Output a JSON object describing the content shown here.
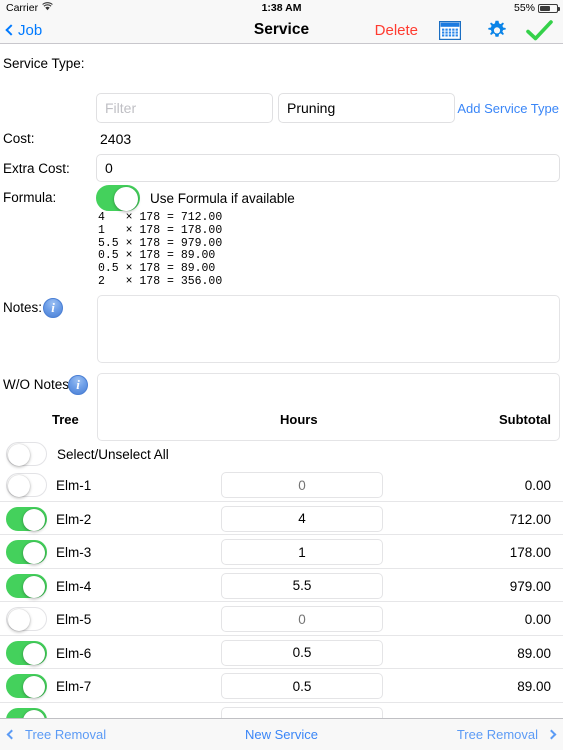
{
  "status_bar": {
    "carrier": "Carrier",
    "wifi_icon": "wifi-icon",
    "time": "1:38 AM",
    "battery_percent": "55%",
    "battery_level": 55
  },
  "nav_bar": {
    "back_label": "Job",
    "back_icon": "chevron-left-icon",
    "title": "Service",
    "delete_label": "Delete",
    "calendar_icon": "calendar-icon",
    "gear_icon": "gear-icon",
    "confirm_icon": "checkmark-icon",
    "delete_color": "#ff3b30",
    "tint_color": "#007aff",
    "confirm_color": "#4cd964"
  },
  "form": {
    "service_type_label": "Service Type:",
    "filter_placeholder": "Filter",
    "filter_value": "",
    "service_type_value": "Pruning",
    "add_service_type_label": "Add Service Type",
    "cost_label": "Cost:",
    "cost_value": "2403",
    "extra_cost_label": "Extra Cost:",
    "extra_cost_value": "0",
    "formula_label": "Formula:",
    "formula_toggle_label": "Use Formula if available",
    "formula_toggle_on": true,
    "formula_lines": "4   × 178 = 712.00\n1   × 178 = 178.00\n5.5 × 178 = 979.00\n0.5 × 178 = 89.00\n0.5 × 178 = 89.00\n2   × 178 = 356.00",
    "notes_label": "Notes:",
    "notes_info_icon": "info-icon",
    "notes_value": "",
    "wo_notes_label": "W/O Notes:",
    "wo_notes_info_icon": "info-icon",
    "wo_notes_value": ""
  },
  "table": {
    "headers": {
      "tree": "Tree",
      "hours": "Hours",
      "subtotal": "Subtotal"
    },
    "select_all_label": "Select/Unselect All",
    "select_all_on": false,
    "rows": [
      {
        "name": "Elm-1",
        "selected": false,
        "hours": "0",
        "hours_is_placeholder": true,
        "subtotal": "0.00"
      },
      {
        "name": "Elm-2",
        "selected": true,
        "hours": "4",
        "hours_is_placeholder": false,
        "subtotal": "712.00"
      },
      {
        "name": "Elm-3",
        "selected": true,
        "hours": "1",
        "hours_is_placeholder": false,
        "subtotal": "178.00"
      },
      {
        "name": "Elm-4",
        "selected": true,
        "hours": "5.5",
        "hours_is_placeholder": false,
        "subtotal": "979.00"
      },
      {
        "name": "Elm-5",
        "selected": false,
        "hours": "0",
        "hours_is_placeholder": true,
        "subtotal": "0.00"
      },
      {
        "name": "Elm-6",
        "selected": true,
        "hours": "0.5",
        "hours_is_placeholder": false,
        "subtotal": "89.00"
      },
      {
        "name": "Elm-7",
        "selected": true,
        "hours": "0.5",
        "hours_is_placeholder": false,
        "subtotal": "89.00"
      },
      {
        "name": "",
        "selected": true,
        "hours": "",
        "hours_is_placeholder": false,
        "subtotal": ""
      }
    ]
  },
  "toolbar": {
    "prev_icon": "chevron-left-icon",
    "prev_label": "Tree Removal",
    "center_label": "New Service",
    "next_label": "Tree Removal",
    "next_icon": "chevron-right-icon",
    "tint_color": "#5c9bf5"
  }
}
